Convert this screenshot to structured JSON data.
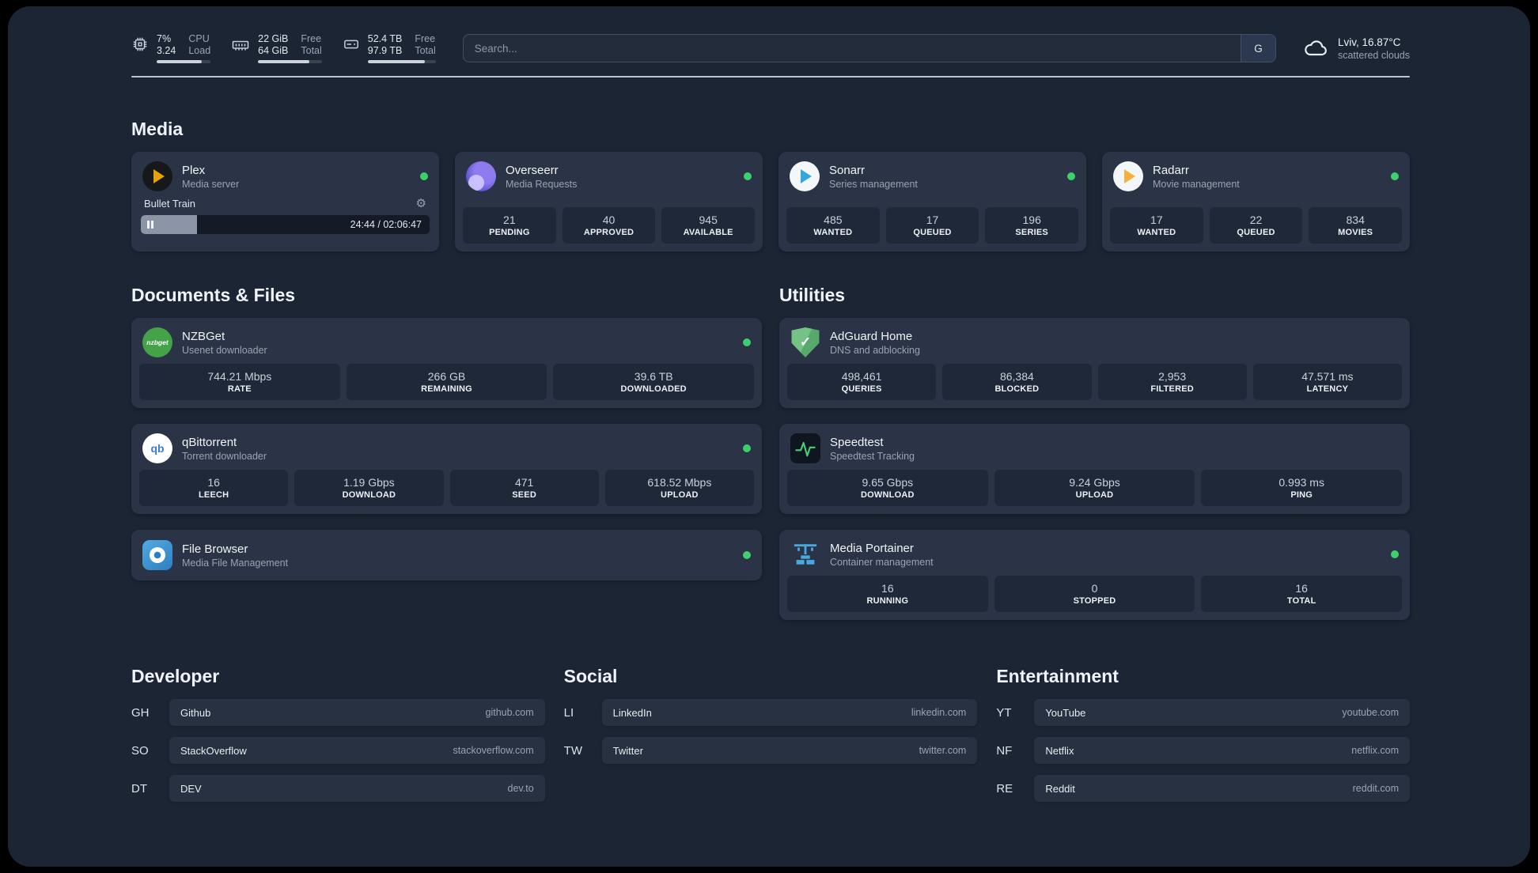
{
  "theme": {
    "background": "#1b2534",
    "card": "#2a3446",
    "stat_box": "#1e2838",
    "status_online": "#3ecf6f",
    "accent_text": "#eef1f5",
    "muted_text": "#9aa3b2"
  },
  "icons": {
    "gear_glyph": "⚙",
    "check_glyph": "✓"
  },
  "header": {
    "cpu": {
      "percent": "7%",
      "value": "3.24",
      "label_top": "CPU",
      "label_bottom": "Load",
      "bar": "84%"
    },
    "memory": {
      "free": "22 GiB",
      "total": "64 GiB",
      "label_top": "Free",
      "label_bottom": "Total",
      "bar": "80%"
    },
    "disk": {
      "free": "52.4 TB",
      "total": "97.9 TB",
      "label_top": "Free",
      "label_bottom": "Total",
      "bar": "84%"
    },
    "search": {
      "placeholder": "Search...",
      "engine": "G"
    },
    "weather": {
      "location": "Lviv, 16.87°C",
      "condition": "scattered clouds"
    }
  },
  "media": {
    "title": "Media",
    "plex": {
      "name": "Plex",
      "subtitle": "Media server",
      "status": "online",
      "player": {
        "track": "Bullet Train",
        "time": "24:44 / 02:06:47",
        "progress": "19.5%"
      }
    },
    "overseerr": {
      "name": "Overseerr",
      "subtitle": "Media Requests",
      "status": "online",
      "stats": [
        {
          "value": "21",
          "label": "PENDING"
        },
        {
          "value": "40",
          "label": "APPROVED"
        },
        {
          "value": "945",
          "label": "AVAILABLE"
        }
      ]
    },
    "sonarr": {
      "name": "Sonarr",
      "subtitle": "Series management",
      "status": "online",
      "stats": [
        {
          "value": "485",
          "label": "WANTED"
        },
        {
          "value": "17",
          "label": "QUEUED"
        },
        {
          "value": "196",
          "label": "SERIES"
        }
      ]
    },
    "radarr": {
      "name": "Radarr",
      "subtitle": "Movie management",
      "status": "online",
      "stats": [
        {
          "value": "17",
          "label": "WANTED"
        },
        {
          "value": "22",
          "label": "QUEUED"
        },
        {
          "value": "834",
          "label": "MOVIES"
        }
      ]
    }
  },
  "documents": {
    "title": "Documents & Files",
    "nzbget": {
      "name": "NZBGet",
      "subtitle": "Usenet downloader",
      "status": "online",
      "icon_text": "nzbget",
      "stats": [
        {
          "value": "744.21 Mbps",
          "label": "RATE"
        },
        {
          "value": "266 GB",
          "label": "REMAINING"
        },
        {
          "value": "39.6 TB",
          "label": "DOWNLOADED"
        }
      ]
    },
    "qbittorrent": {
      "name": "qBittorrent",
      "subtitle": "Torrent downloader",
      "status": "online",
      "icon_text": "qb",
      "stats": [
        {
          "value": "16",
          "label": "LEECH"
        },
        {
          "value": "1.19 Gbps",
          "label": "DOWNLOAD"
        },
        {
          "value": "471",
          "label": "SEED"
        },
        {
          "value": "618.52 Mbps",
          "label": "UPLOAD"
        }
      ]
    },
    "filebrowser": {
      "name": "File Browser",
      "subtitle": "Media File Management",
      "status": "online"
    }
  },
  "utilities": {
    "title": "Utilities",
    "adguard": {
      "name": "AdGuard Home",
      "subtitle": "DNS and adblocking",
      "stats": [
        {
          "value": "498,461",
          "label": "QUERIES"
        },
        {
          "value": "86,384",
          "label": "BLOCKED"
        },
        {
          "value": "2,953",
          "label": "FILTERED"
        },
        {
          "value": "47.571 ms",
          "label": "LATENCY"
        }
      ]
    },
    "speedtest": {
      "name": "Speedtest",
      "subtitle": "Speedtest Tracking",
      "stats": [
        {
          "value": "9.65 Gbps",
          "label": "DOWNLOAD"
        },
        {
          "value": "9.24 Gbps",
          "label": "UPLOAD"
        },
        {
          "value": "0.993 ms",
          "label": "PING"
        }
      ]
    },
    "portainer": {
      "name": "Media Portainer",
      "subtitle": "Container management",
      "status": "online",
      "stats": [
        {
          "value": "16",
          "label": "RUNNING"
        },
        {
          "value": "0",
          "label": "STOPPED"
        },
        {
          "value": "16",
          "label": "TOTAL"
        }
      ]
    }
  },
  "bookmarks": {
    "developer": {
      "title": "Developer",
      "items": [
        {
          "abbr": "GH",
          "name": "Github",
          "url": "github.com"
        },
        {
          "abbr": "SO",
          "name": "StackOverflow",
          "url": "stackoverflow.com"
        },
        {
          "abbr": "DT",
          "name": "DEV",
          "url": "dev.to"
        }
      ]
    },
    "social": {
      "title": "Social",
      "items": [
        {
          "abbr": "LI",
          "name": "LinkedIn",
          "url": "linkedin.com"
        },
        {
          "abbr": "TW",
          "name": "Twitter",
          "url": "twitter.com"
        }
      ]
    },
    "entertainment": {
      "title": "Entertainment",
      "items": [
        {
          "abbr": "YT",
          "name": "YouTube",
          "url": "youtube.com"
        },
        {
          "abbr": "NF",
          "name": "Netflix",
          "url": "netflix.com"
        },
        {
          "abbr": "RE",
          "name": "Reddit",
          "url": "reddit.com"
        }
      ]
    }
  }
}
